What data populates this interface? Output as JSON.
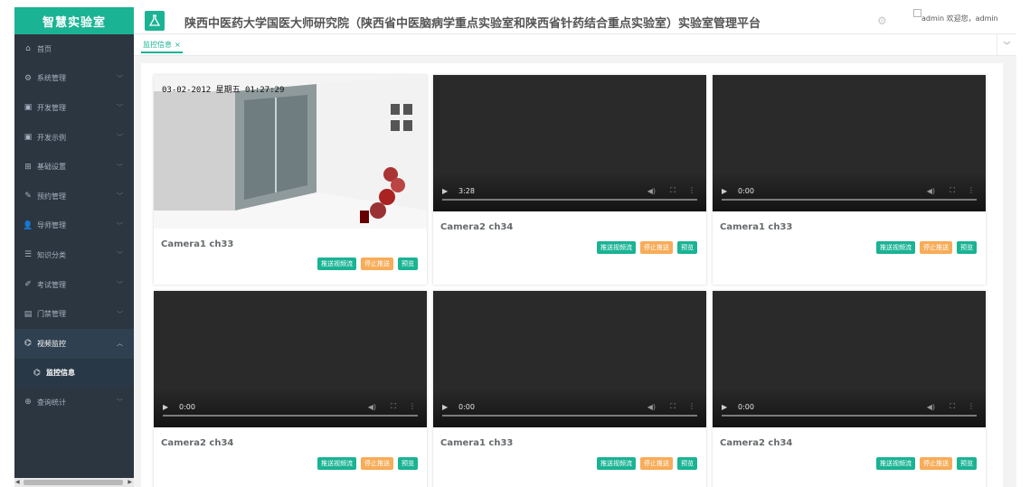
{
  "app": {
    "brand": "智慧实验室",
    "site_title": "陕西中医药大学国医大师研究院（陕西省中医脑病学重点实验室和陕西省针药结合重点实验室）实验室管理平台",
    "user_img_alt": "admin",
    "welcome": "欢迎您，admin"
  },
  "sidebar": {
    "items": [
      {
        "label": "首页",
        "icon": "home-icon",
        "glyph": "⌂",
        "has_arrow": false
      },
      {
        "label": "系统管理",
        "icon": "gear-icon",
        "glyph": "⚙",
        "has_arrow": true
      },
      {
        "label": "开发管理",
        "icon": "monitor-icon",
        "glyph": "▣",
        "has_arrow": true
      },
      {
        "label": "开发示例",
        "icon": "monitor-icon",
        "glyph": "▣",
        "has_arrow": true
      },
      {
        "label": "基础设置",
        "icon": "grid-icon",
        "glyph": "⊞",
        "has_arrow": true
      },
      {
        "label": "预约管理",
        "icon": "edit-icon",
        "glyph": "✎",
        "has_arrow": true
      },
      {
        "label": "导师管理",
        "icon": "user-icon",
        "glyph": "👤",
        "has_arrow": true
      },
      {
        "label": "知识分类",
        "icon": "list-icon",
        "glyph": "☰",
        "has_arrow": true
      },
      {
        "label": "考试管理",
        "icon": "pen-icon",
        "glyph": "✐",
        "has_arrow": true
      },
      {
        "label": "门禁管理",
        "icon": "door-icon",
        "glyph": "▤",
        "has_arrow": true
      },
      {
        "label": "视频监控",
        "icon": "camera-icon",
        "glyph": "⌬",
        "has_arrow": true,
        "open": true
      },
      {
        "label": "监控信息",
        "icon": "camera-icon",
        "glyph": "⌬",
        "sub": true
      },
      {
        "label": "查询统计",
        "icon": "search-icon",
        "glyph": "⊕",
        "has_arrow": true
      }
    ]
  },
  "tabs": {
    "active": "监控信息",
    "close": "×",
    "toggle": "﹀"
  },
  "cameras": [
    {
      "title": "Camera1 ch33",
      "time": "",
      "playing": true,
      "osd": "03-02-2012 星期五 01:27:29"
    },
    {
      "title": "Camera2 ch34",
      "time": "3:28",
      "playing": false
    },
    {
      "title": "Camera1 ch33",
      "time": "0:00",
      "playing": false
    },
    {
      "title": "Camera2 ch34",
      "time": "0:00",
      "playing": false
    },
    {
      "title": "Camera1 ch33",
      "time": "0:00",
      "playing": false
    },
    {
      "title": "Camera2 ch34",
      "time": "0:00",
      "playing": false
    }
  ],
  "buttons": {
    "push": "推送视频流",
    "stop": "停止推送",
    "preview": "预览"
  },
  "colors": {
    "accent": "#1ab394",
    "warning": "#f8ac59",
    "sidebar": "#2b3640"
  }
}
